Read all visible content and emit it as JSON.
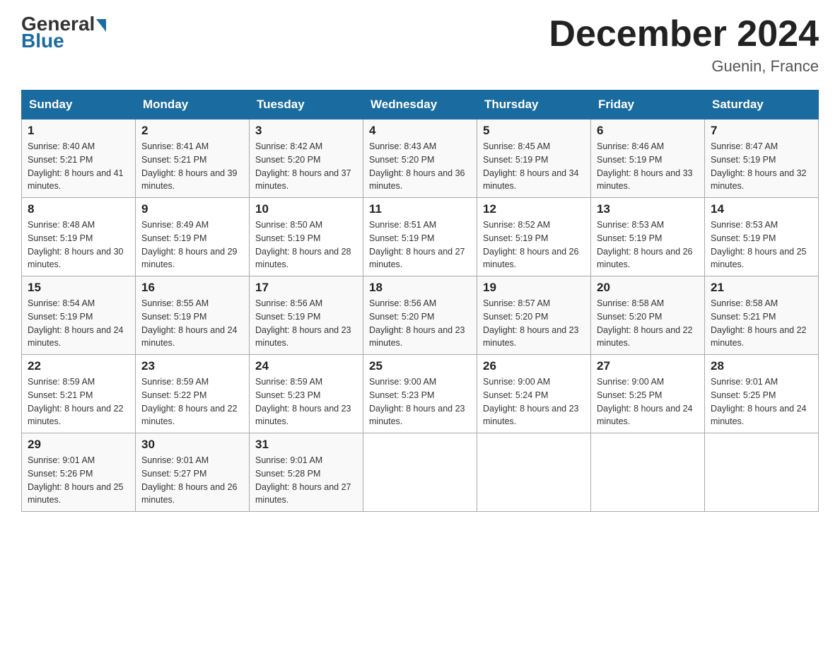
{
  "header": {
    "logo_general": "General",
    "logo_arrow": "",
    "logo_blue": "Blue",
    "month_title": "December 2024",
    "location": "Guenin, France"
  },
  "weekdays": [
    "Sunday",
    "Monday",
    "Tuesday",
    "Wednesday",
    "Thursday",
    "Friday",
    "Saturday"
  ],
  "weeks": [
    [
      {
        "day": "1",
        "sunrise": "8:40 AM",
        "sunset": "5:21 PM",
        "daylight": "8 hours and 41 minutes."
      },
      {
        "day": "2",
        "sunrise": "8:41 AM",
        "sunset": "5:21 PM",
        "daylight": "8 hours and 39 minutes."
      },
      {
        "day": "3",
        "sunrise": "8:42 AM",
        "sunset": "5:20 PM",
        "daylight": "8 hours and 37 minutes."
      },
      {
        "day": "4",
        "sunrise": "8:43 AM",
        "sunset": "5:20 PM",
        "daylight": "8 hours and 36 minutes."
      },
      {
        "day": "5",
        "sunrise": "8:45 AM",
        "sunset": "5:19 PM",
        "daylight": "8 hours and 34 minutes."
      },
      {
        "day": "6",
        "sunrise": "8:46 AM",
        "sunset": "5:19 PM",
        "daylight": "8 hours and 33 minutes."
      },
      {
        "day": "7",
        "sunrise": "8:47 AM",
        "sunset": "5:19 PM",
        "daylight": "8 hours and 32 minutes."
      }
    ],
    [
      {
        "day": "8",
        "sunrise": "8:48 AM",
        "sunset": "5:19 PM",
        "daylight": "8 hours and 30 minutes."
      },
      {
        "day": "9",
        "sunrise": "8:49 AM",
        "sunset": "5:19 PM",
        "daylight": "8 hours and 29 minutes."
      },
      {
        "day": "10",
        "sunrise": "8:50 AM",
        "sunset": "5:19 PM",
        "daylight": "8 hours and 28 minutes."
      },
      {
        "day": "11",
        "sunrise": "8:51 AM",
        "sunset": "5:19 PM",
        "daylight": "8 hours and 27 minutes."
      },
      {
        "day": "12",
        "sunrise": "8:52 AM",
        "sunset": "5:19 PM",
        "daylight": "8 hours and 26 minutes."
      },
      {
        "day": "13",
        "sunrise": "8:53 AM",
        "sunset": "5:19 PM",
        "daylight": "8 hours and 26 minutes."
      },
      {
        "day": "14",
        "sunrise": "8:53 AM",
        "sunset": "5:19 PM",
        "daylight": "8 hours and 25 minutes."
      }
    ],
    [
      {
        "day": "15",
        "sunrise": "8:54 AM",
        "sunset": "5:19 PM",
        "daylight": "8 hours and 24 minutes."
      },
      {
        "day": "16",
        "sunrise": "8:55 AM",
        "sunset": "5:19 PM",
        "daylight": "8 hours and 24 minutes."
      },
      {
        "day": "17",
        "sunrise": "8:56 AM",
        "sunset": "5:19 PM",
        "daylight": "8 hours and 23 minutes."
      },
      {
        "day": "18",
        "sunrise": "8:56 AM",
        "sunset": "5:20 PM",
        "daylight": "8 hours and 23 minutes."
      },
      {
        "day": "19",
        "sunrise": "8:57 AM",
        "sunset": "5:20 PM",
        "daylight": "8 hours and 23 minutes."
      },
      {
        "day": "20",
        "sunrise": "8:58 AM",
        "sunset": "5:20 PM",
        "daylight": "8 hours and 22 minutes."
      },
      {
        "day": "21",
        "sunrise": "8:58 AM",
        "sunset": "5:21 PM",
        "daylight": "8 hours and 22 minutes."
      }
    ],
    [
      {
        "day": "22",
        "sunrise": "8:59 AM",
        "sunset": "5:21 PM",
        "daylight": "8 hours and 22 minutes."
      },
      {
        "day": "23",
        "sunrise": "8:59 AM",
        "sunset": "5:22 PM",
        "daylight": "8 hours and 22 minutes."
      },
      {
        "day": "24",
        "sunrise": "8:59 AM",
        "sunset": "5:23 PM",
        "daylight": "8 hours and 23 minutes."
      },
      {
        "day": "25",
        "sunrise": "9:00 AM",
        "sunset": "5:23 PM",
        "daylight": "8 hours and 23 minutes."
      },
      {
        "day": "26",
        "sunrise": "9:00 AM",
        "sunset": "5:24 PM",
        "daylight": "8 hours and 23 minutes."
      },
      {
        "day": "27",
        "sunrise": "9:00 AM",
        "sunset": "5:25 PM",
        "daylight": "8 hours and 24 minutes."
      },
      {
        "day": "28",
        "sunrise": "9:01 AM",
        "sunset": "5:25 PM",
        "daylight": "8 hours and 24 minutes."
      }
    ],
    [
      {
        "day": "29",
        "sunrise": "9:01 AM",
        "sunset": "5:26 PM",
        "daylight": "8 hours and 25 minutes."
      },
      {
        "day": "30",
        "sunrise": "9:01 AM",
        "sunset": "5:27 PM",
        "daylight": "8 hours and 26 minutes."
      },
      {
        "day": "31",
        "sunrise": "9:01 AM",
        "sunset": "5:28 PM",
        "daylight": "8 hours and 27 minutes."
      },
      null,
      null,
      null,
      null
    ]
  ]
}
